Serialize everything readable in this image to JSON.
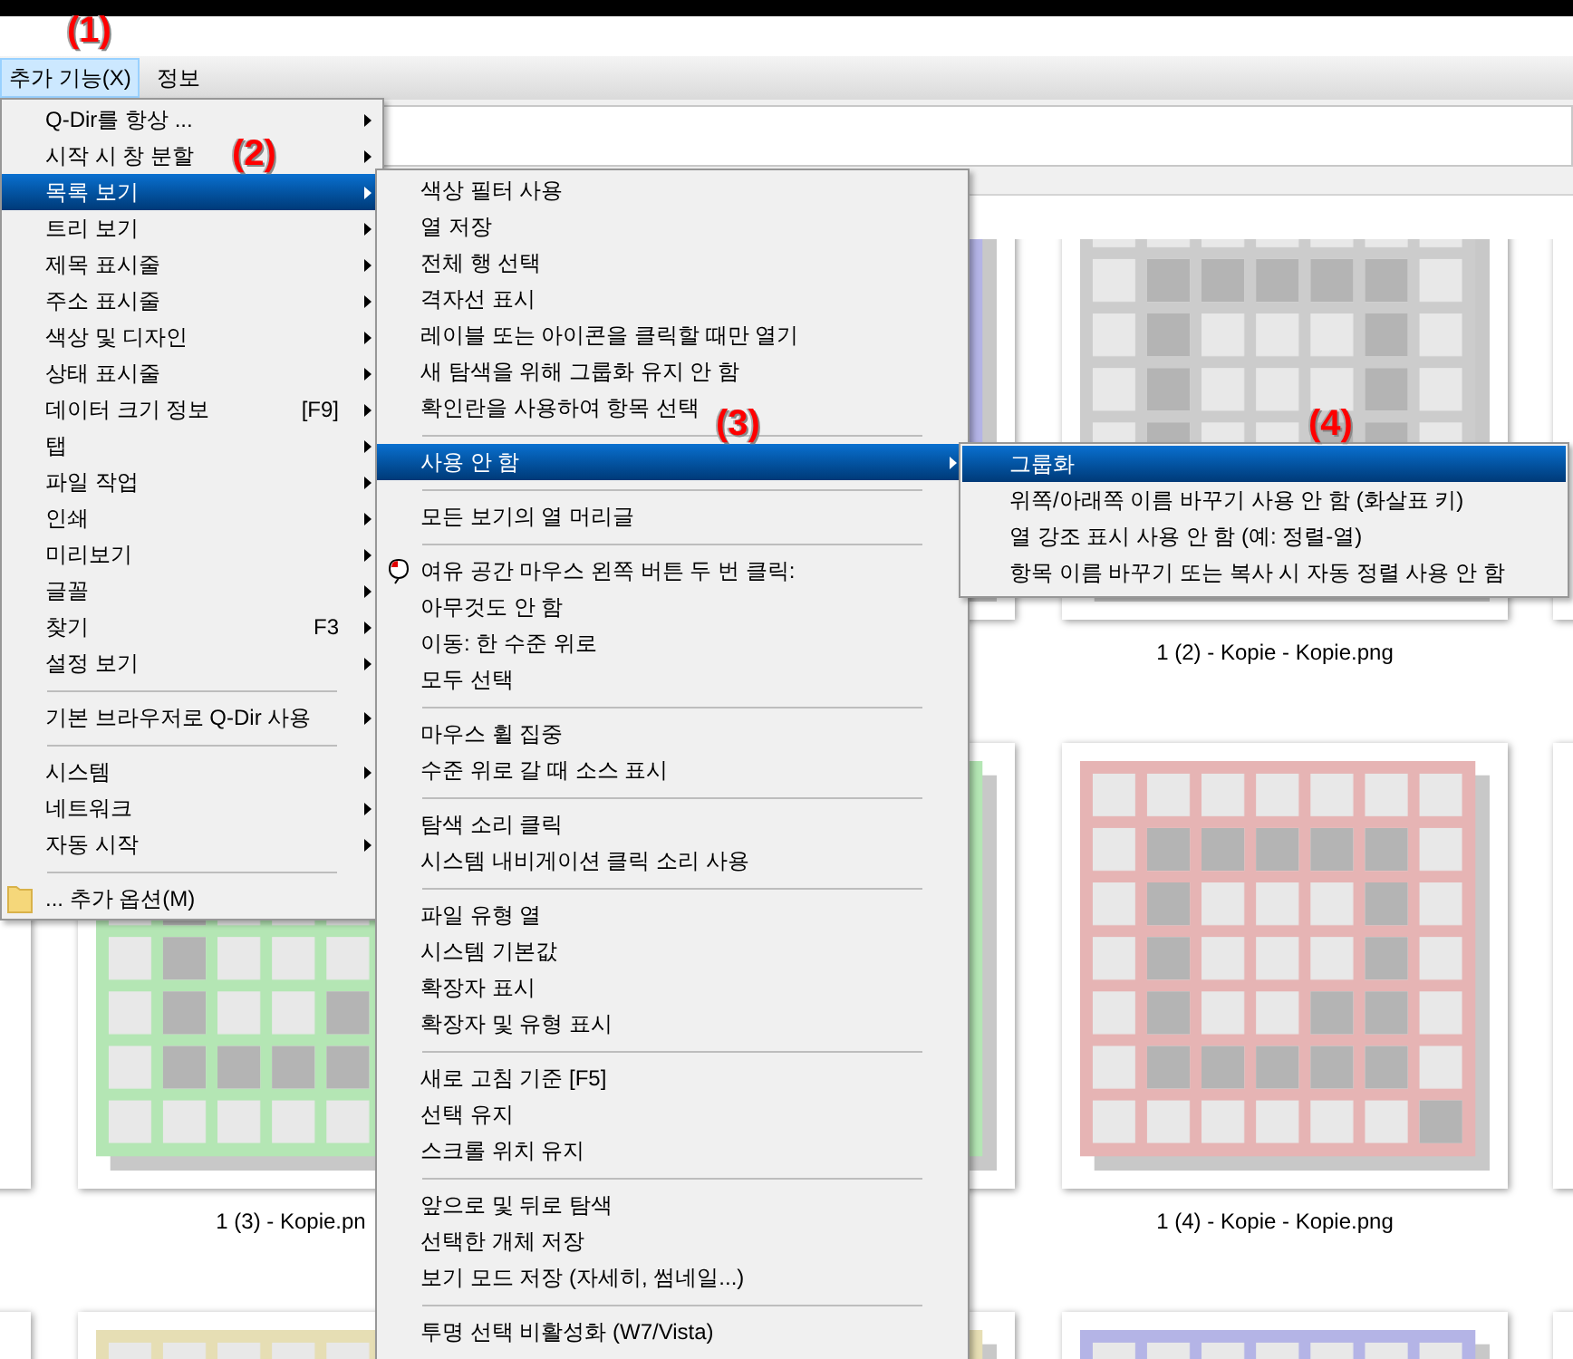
{
  "menubar": [
    {
      "label": "추가 기능(X)",
      "selected": true
    },
    {
      "label": "정보",
      "selected": false
    }
  ],
  "main_menu": {
    "items": [
      {
        "kind": "item",
        "label": "Q-Dir를 항상 ...",
        "submenu": true,
        "selected": false
      },
      {
        "kind": "item",
        "label": "시작 시 창 분할",
        "submenu": true,
        "selected": false
      },
      {
        "kind": "item",
        "label": "목록 보기",
        "submenu": true,
        "selected": true
      },
      {
        "kind": "item",
        "label": "트리 보기",
        "submenu": true,
        "selected": false
      },
      {
        "kind": "item",
        "label": "제목 표시줄",
        "submenu": true,
        "selected": false
      },
      {
        "kind": "item",
        "label": "주소 표시줄",
        "submenu": true,
        "selected": false
      },
      {
        "kind": "item",
        "label": "색상 및 디자인",
        "submenu": true,
        "selected": false
      },
      {
        "kind": "item",
        "label": "상태 표시줄",
        "submenu": true,
        "selected": false
      },
      {
        "kind": "item",
        "label": "데이터 크기 정보",
        "shortcut": "[F9]",
        "submenu": true,
        "selected": false
      },
      {
        "kind": "item",
        "label": "탭",
        "submenu": true,
        "selected": false
      },
      {
        "kind": "item",
        "label": "파일 작업",
        "submenu": true,
        "selected": false
      },
      {
        "kind": "item",
        "label": "인쇄",
        "submenu": true,
        "selected": false
      },
      {
        "kind": "item",
        "label": "미리보기",
        "submenu": true,
        "selected": false
      },
      {
        "kind": "item",
        "label": "글꼴",
        "submenu": true,
        "selected": false
      },
      {
        "kind": "item",
        "label": "찾기",
        "shortcut": "F3",
        "submenu": true,
        "selected": false
      },
      {
        "kind": "item",
        "label": "설정 보기",
        "submenu": true,
        "selected": false
      },
      {
        "kind": "separator"
      },
      {
        "kind": "item",
        "label": "기본 브라우저로 Q-Dir 사용",
        "submenu": true,
        "selected": false
      },
      {
        "kind": "separator"
      },
      {
        "kind": "item",
        "label": "시스템",
        "submenu": true,
        "selected": false
      },
      {
        "kind": "item",
        "label": "네트워크",
        "submenu": true,
        "selected": false
      },
      {
        "kind": "item",
        "label": "자동 시작",
        "submenu": true,
        "selected": false
      },
      {
        "kind": "separator"
      },
      {
        "kind": "folder",
        "label": "... 추가 옵션(M)",
        "submenu": false,
        "selected": false
      }
    ]
  },
  "list_view_menu": {
    "items": [
      {
        "kind": "item",
        "label": "색상 필터 사용",
        "submenu": false,
        "selected": false
      },
      {
        "kind": "item",
        "label": "열 저장",
        "submenu": false,
        "selected": false
      },
      {
        "kind": "item",
        "label": "전체 행 선택",
        "submenu": false,
        "selected": false
      },
      {
        "kind": "item",
        "label": "격자선 표시",
        "submenu": false,
        "selected": false
      },
      {
        "kind": "item",
        "label": "레이블 또는 아이콘을 클릭할 때만 열기",
        "submenu": false,
        "selected": false
      },
      {
        "kind": "item",
        "label": "새 탐색을 위해 그룹화 유지 안 함",
        "submenu": false,
        "selected": false
      },
      {
        "kind": "item",
        "label": "확인란을 사용하여 항목 선택",
        "submenu": false,
        "selected": false
      },
      {
        "kind": "separator"
      },
      {
        "kind": "item",
        "label": "사용 안 함",
        "submenu": true,
        "selected": true
      },
      {
        "kind": "separator"
      },
      {
        "kind": "item",
        "label": "모든 보기의 열 머리글",
        "submenu": false,
        "selected": false
      },
      {
        "kind": "separator"
      },
      {
        "kind": "mouse",
        "label": "여유 공간 마우스 왼쪽 버튼 두 번 클릭:",
        "submenu": false,
        "selected": false
      },
      {
        "kind": "item",
        "label": "아무것도 안 함",
        "submenu": false,
        "selected": false
      },
      {
        "kind": "item",
        "label": "이동: 한 수준 위로",
        "submenu": false,
        "selected": false
      },
      {
        "kind": "item",
        "label": "모두 선택",
        "submenu": false,
        "selected": false
      },
      {
        "kind": "separator"
      },
      {
        "kind": "item",
        "label": "마우스 휠 집중",
        "submenu": false,
        "selected": false
      },
      {
        "kind": "item",
        "label": "수준 위로 갈 때 소스 표시",
        "submenu": false,
        "selected": false
      },
      {
        "kind": "separator"
      },
      {
        "kind": "item",
        "label": "탐색 소리 클릭",
        "submenu": false,
        "selected": false
      },
      {
        "kind": "item",
        "label": "시스템 내비게이션 클릭 소리 사용",
        "submenu": false,
        "selected": false
      },
      {
        "kind": "separator"
      },
      {
        "kind": "item",
        "label": "파일 유형 열",
        "submenu": false,
        "selected": false
      },
      {
        "kind": "item",
        "label": "시스템 기본값",
        "submenu": false,
        "selected": false
      },
      {
        "kind": "item",
        "label": "확장자 표시",
        "submenu": false,
        "selected": false
      },
      {
        "kind": "item",
        "label": "확장자 및 유형 표시",
        "submenu": false,
        "selected": false
      },
      {
        "kind": "separator"
      },
      {
        "kind": "item",
        "label": "새로 고침 기준 [F5]",
        "submenu": false,
        "selected": false
      },
      {
        "kind": "item",
        "label": "선택 유지",
        "submenu": false,
        "selected": false
      },
      {
        "kind": "item",
        "label": "스크롤 위치 유지",
        "submenu": false,
        "selected": false
      },
      {
        "kind": "separator"
      },
      {
        "kind": "item",
        "label": "앞으로 및 뒤로 탐색",
        "submenu": false,
        "selected": false
      },
      {
        "kind": "item",
        "label": "선택한 개체 저장",
        "submenu": false,
        "selected": false
      },
      {
        "kind": "item",
        "label": "보기 모드 저장 (자세히, 썸네일...)",
        "submenu": false,
        "selected": false
      },
      {
        "kind": "separator"
      },
      {
        "kind": "item",
        "label": "투명 선택 비활성화 (W7/Vista)",
        "submenu": false,
        "selected": false
      }
    ]
  },
  "disable_menu": {
    "items": [
      {
        "kind": "item",
        "label": "그룹화",
        "submenu": false,
        "selected": true
      },
      {
        "kind": "item",
        "label": "위쪽/아래쪽 이름 바꾸기 사용 안 함 (화살표 키)",
        "submenu": false,
        "selected": false
      },
      {
        "kind": "item",
        "label": "열 강조 표시 사용 안 함 (예: 정렬-열)",
        "submenu": false,
        "selected": false
      },
      {
        "kind": "item",
        "label": "항목 이름 바꾸기 또는 복사 시 자동 정렬 사용 안 함",
        "submenu": false,
        "selected": false
      }
    ]
  },
  "thumbnail_rows": [
    [
      {
        "kind": "picture",
        "color": "#b4b4e6"
      },
      {
        "kind": "picture",
        "color": "#cccccc",
        "label": "1 (2) - Kopie - Kopie.png"
      },
      {
        "kind": "card"
      }
    ],
    [
      {
        "kind": "card"
      },
      {
        "kind": "picture",
        "color": "#b4e6b4",
        "label": "1 (3) - Kopie.pn"
      },
      {
        "kind": "picture",
        "color": "#b4e6b4"
      },
      {
        "kind": "picture",
        "color": "#e6b4b4",
        "label": "1 (4) - Kopie - Kopie.png"
      },
      {
        "kind": "card"
      }
    ],
    [
      {
        "kind": "card"
      },
      {
        "kind": "picture",
        "color": "#e6deb4"
      },
      {
        "kind": "picture",
        "color": "#e6deb4"
      },
      {
        "kind": "picture",
        "color": "#b4b4e6"
      },
      {
        "kind": "card"
      }
    ]
  ],
  "annotations": [
    "(1)",
    "(2)",
    "(3)",
    "(4)"
  ]
}
